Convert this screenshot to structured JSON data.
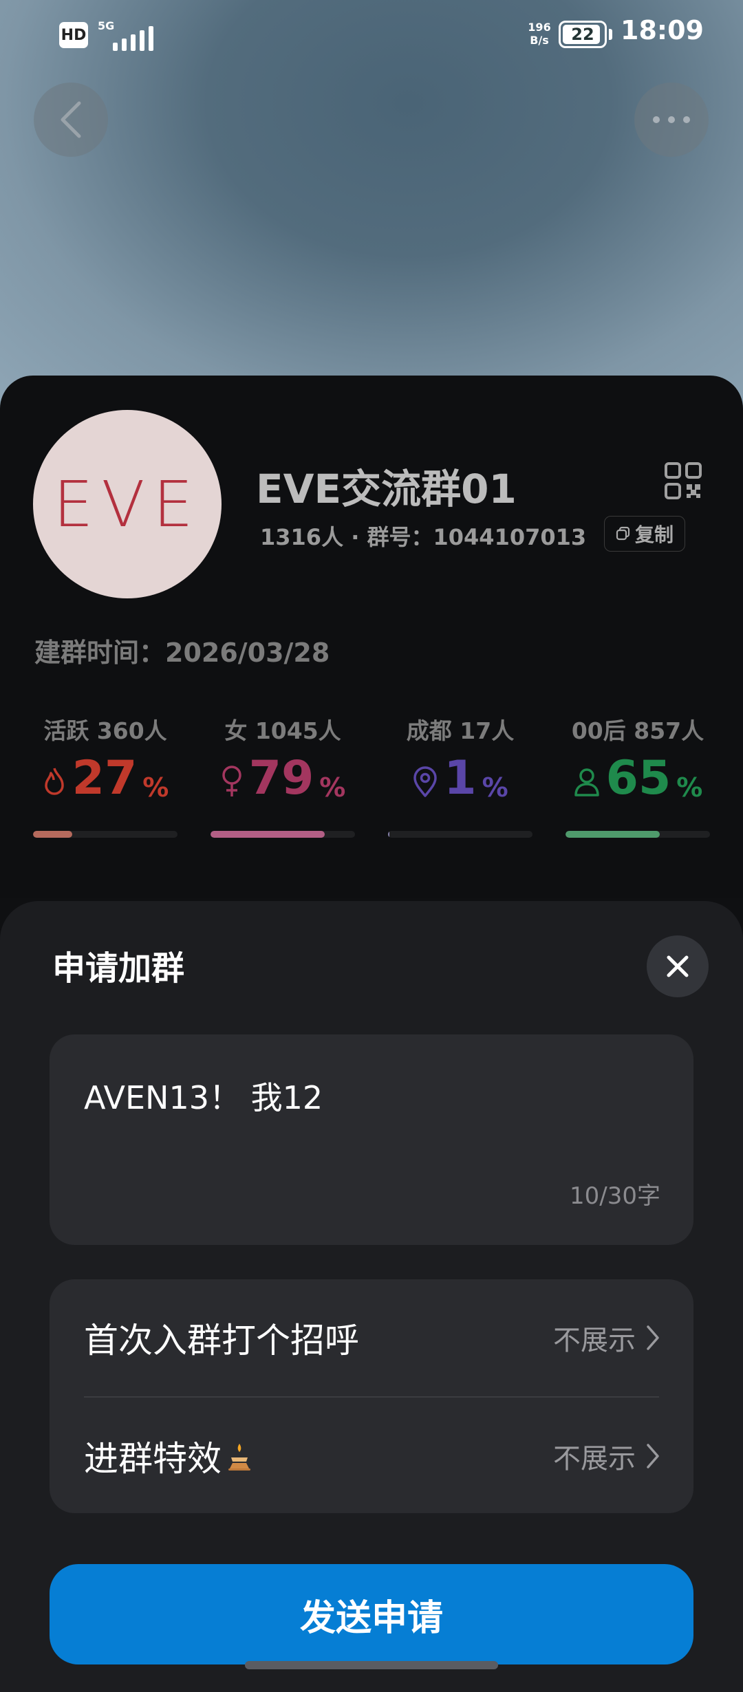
{
  "status_bar": {
    "hd": "HD",
    "network": "5G",
    "speed_value": "196",
    "speed_unit": "B/s",
    "battery": "22",
    "time": "18:09"
  },
  "header": {
    "back_icon": "chevron-left-icon",
    "more_icon": "more-horizontal-icon"
  },
  "group": {
    "avatar_text": "EVE",
    "name": "EVE交流群01",
    "meta": "1316人 · 群号：1044107013",
    "copy_label": "复制",
    "created": "建群时间：2026/03/28",
    "stats": [
      {
        "label": "活跃 360人",
        "value": "27",
        "unit": "%",
        "icon": "flame-icon",
        "color": "#c0392b",
        "bar_color": "#b56a5d",
        "fraction": 0.27
      },
      {
        "label": "女 1045人",
        "value": "79",
        "unit": "%",
        "icon": "female-icon",
        "color": "#a3365f",
        "bar_color": "#b25f85",
        "fraction": 0.79
      },
      {
        "label": "成都 17人",
        "value": "1",
        "unit": "%",
        "icon": "location-icon",
        "color": "#5a46a8",
        "bar_color": "#8b86b0",
        "fraction": 0.01
      },
      {
        "label": "00后 857人",
        "value": "65",
        "unit": "%",
        "icon": "person-icon",
        "color": "#1f8a4c",
        "bar_color": "#4f9a6c",
        "fraction": 0.65
      }
    ]
  },
  "sheet": {
    "title": "申请加群",
    "message": "AVEN13！ 我12",
    "counter": "10/30字",
    "options": [
      {
        "label": "首次入群打个招呼",
        "value": "不展示"
      },
      {
        "label": "进群特效",
        "value": "不展示",
        "icon": "effect-icon"
      }
    ],
    "submit_label": "发送申请"
  },
  "colors": {
    "accent": "#067ed4",
    "sheet_bg": "#1c1d20"
  }
}
